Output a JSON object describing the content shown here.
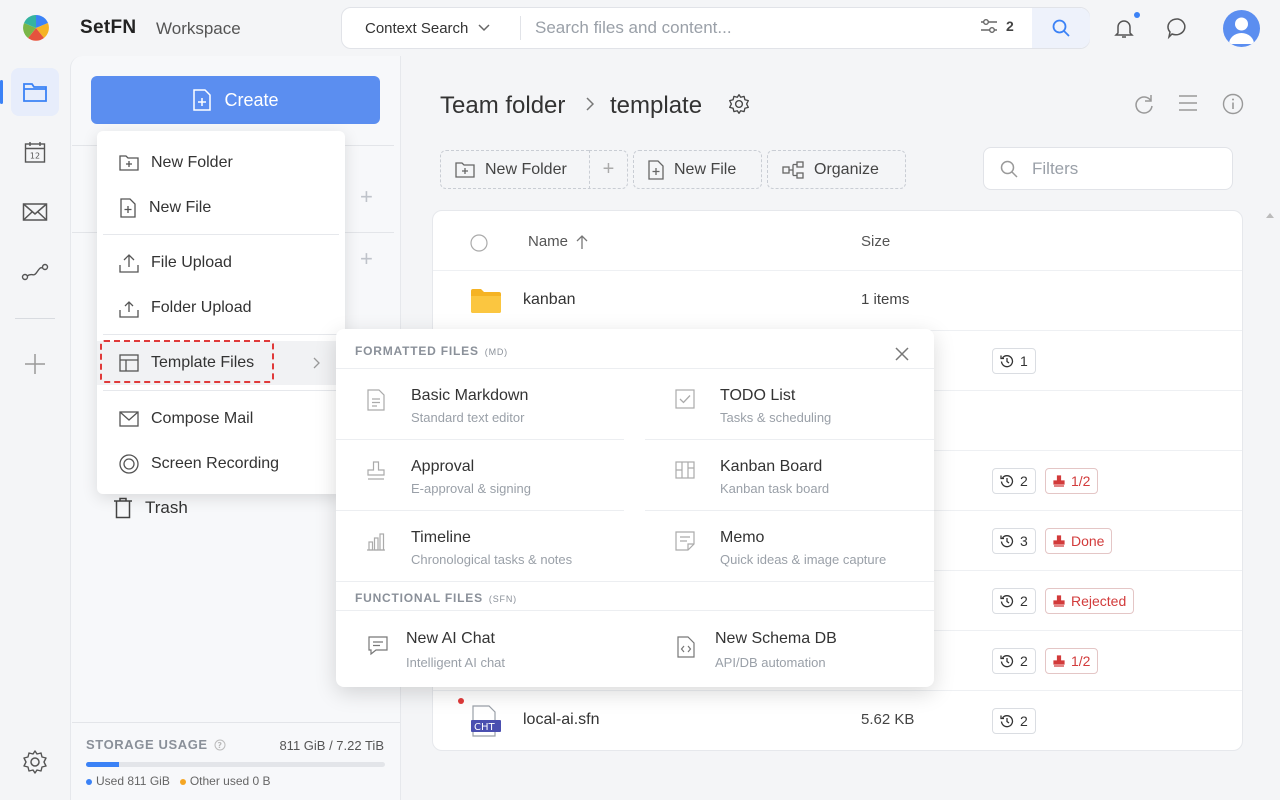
{
  "header": {
    "brand": "SetFN",
    "workspace": "Workspace",
    "context_search_label": "Context Search",
    "search_placeholder": "Search files and content...",
    "filter_count": "2"
  },
  "sidebar": {
    "create_label": "Create",
    "trash_label": "Trash",
    "storage": {
      "label": "STORAGE USAGE",
      "total": "811 GiB / 7.22 TiB",
      "used_label": "Used 811 GiB",
      "other_label": "Other used 0 B",
      "used_fraction": 0.11
    }
  },
  "create_menu": {
    "items": [
      {
        "label": "New Folder",
        "icon": "folder-plus-icon"
      },
      {
        "label": "New File",
        "icon": "file-plus-icon"
      },
      {
        "label": "File Upload",
        "icon": "upload-icon"
      },
      {
        "label": "Folder Upload",
        "icon": "folder-upload-icon"
      },
      {
        "label": "Template Files",
        "icon": "template-icon"
      },
      {
        "label": "Compose Mail",
        "icon": "mail-icon"
      },
      {
        "label": "Screen Recording",
        "icon": "record-icon"
      }
    ]
  },
  "template_menu": {
    "formatted_title": "FORMATTED FILES",
    "formatted_tag": "(MD)",
    "functional_title": "FUNCTIONAL FILES",
    "functional_tag": "(SFN)",
    "formatted": [
      {
        "title": "Basic Markdown",
        "desc": "Standard text editor"
      },
      {
        "title": "TODO List",
        "desc": "Tasks & scheduling"
      },
      {
        "title": "Approval",
        "desc": "E-approval & signing"
      },
      {
        "title": "Kanban Board",
        "desc": "Kanban task board"
      },
      {
        "title": "Timeline",
        "desc": "Chronological tasks & notes"
      },
      {
        "title": "Memo",
        "desc": "Quick ideas & image capture"
      }
    ],
    "functional": [
      {
        "title": "New AI Chat",
        "desc": "Intelligent AI chat"
      },
      {
        "title": "New Schema DB",
        "desc": "API/DB automation"
      }
    ]
  },
  "main": {
    "breadcrumb_root": "Team folder",
    "breadcrumb_current": "template",
    "toolbar": {
      "new_folder": "New Folder",
      "new_file": "New File",
      "organize": "Organize",
      "filters_placeholder": "Filters"
    },
    "table": {
      "col_name": "Name",
      "col_size": "Size",
      "rows": [
        {
          "name": "kanban",
          "size": "1 items",
          "history": "",
          "status": ""
        },
        {
          "name": "",
          "size": "",
          "history": "1",
          "status": ""
        },
        {
          "name": "",
          "size": "",
          "history": "",
          "status": ""
        },
        {
          "name": "",
          "size": "",
          "history": "2",
          "status": "1/2"
        },
        {
          "name": "",
          "size": "",
          "history": "3",
          "status": "Done"
        },
        {
          "name": "",
          "size": "",
          "history": "2",
          "status": "Rejected"
        },
        {
          "name": "",
          "size": "",
          "history": "2",
          "status": "1/2"
        },
        {
          "name": "local-ai.sfn",
          "size": "5.62 KB",
          "history": "2",
          "status": "",
          "file_badge": "CHT"
        }
      ]
    }
  },
  "colors": {
    "accent": "#5b8ef0",
    "danger": "#d23b3b",
    "folder": "#f5b324"
  }
}
